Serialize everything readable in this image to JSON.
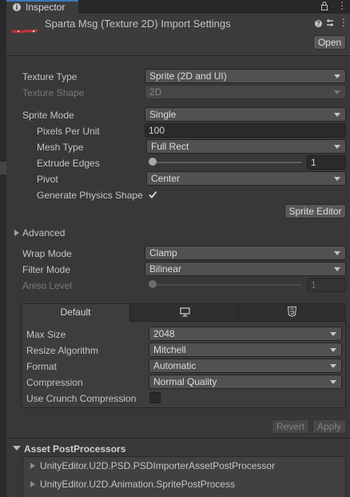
{
  "tab": {
    "title": "Inspector"
  },
  "header": {
    "title": "Sparta Msg (Texture 2D) Import Settings",
    "open_label": "Open"
  },
  "texture": {
    "type_label": "Texture Type",
    "type_value": "Sprite (2D and UI)",
    "shape_label": "Texture Shape",
    "shape_value": "2D"
  },
  "sprite": {
    "mode_label": "Sprite Mode",
    "mode_value": "Single",
    "ppu_label": "Pixels Per Unit",
    "ppu_value": "100",
    "mesh_label": "Mesh Type",
    "mesh_value": "Full Rect",
    "extrude_label": "Extrude Edges",
    "extrude_value": "1",
    "extrude_level": 0.0,
    "pivot_label": "Pivot",
    "pivot_value": "Center",
    "physics_label": "Generate Physics Shape",
    "physics_checked": true,
    "editor_button": "Sprite Editor"
  },
  "advanced": {
    "label": "Advanced",
    "expanded": false
  },
  "wrap": {
    "wrap_label": "Wrap Mode",
    "wrap_value": "Clamp",
    "filter_label": "Filter Mode",
    "filter_value": "Bilinear",
    "aniso_label": "Aniso Level",
    "aniso_value": "1",
    "aniso_level": 0.0
  },
  "platform": {
    "tabs": [
      {
        "label": "Default",
        "icon": ""
      },
      {
        "label": "",
        "icon": "monitor-icon"
      },
      {
        "label": "",
        "icon": "html5-icon"
      }
    ],
    "max_size_label": "Max Size",
    "max_size_value": "2048",
    "resize_label": "Resize Algorithm",
    "resize_value": "Mitchell",
    "format_label": "Format",
    "format_value": "Automatic",
    "compression_label": "Compression",
    "compression_value": "Normal Quality",
    "crunch_label": "Use Crunch Compression",
    "crunch_checked": false
  },
  "actions": {
    "revert_label": "Revert",
    "apply_label": "Apply"
  },
  "postprocessors": {
    "title": "Asset PostProcessors",
    "items": [
      "UnityEditor.U2D.PSD.PSDImporterAssetPostProcessor",
      "UnityEditor.U2D.Animation.SpritePostProcess"
    ]
  },
  "colors": {
    "background": "#383838",
    "header": "#3c3c3c",
    "tab": "#282828",
    "field": "#515151",
    "accent": "#c8303a"
  }
}
